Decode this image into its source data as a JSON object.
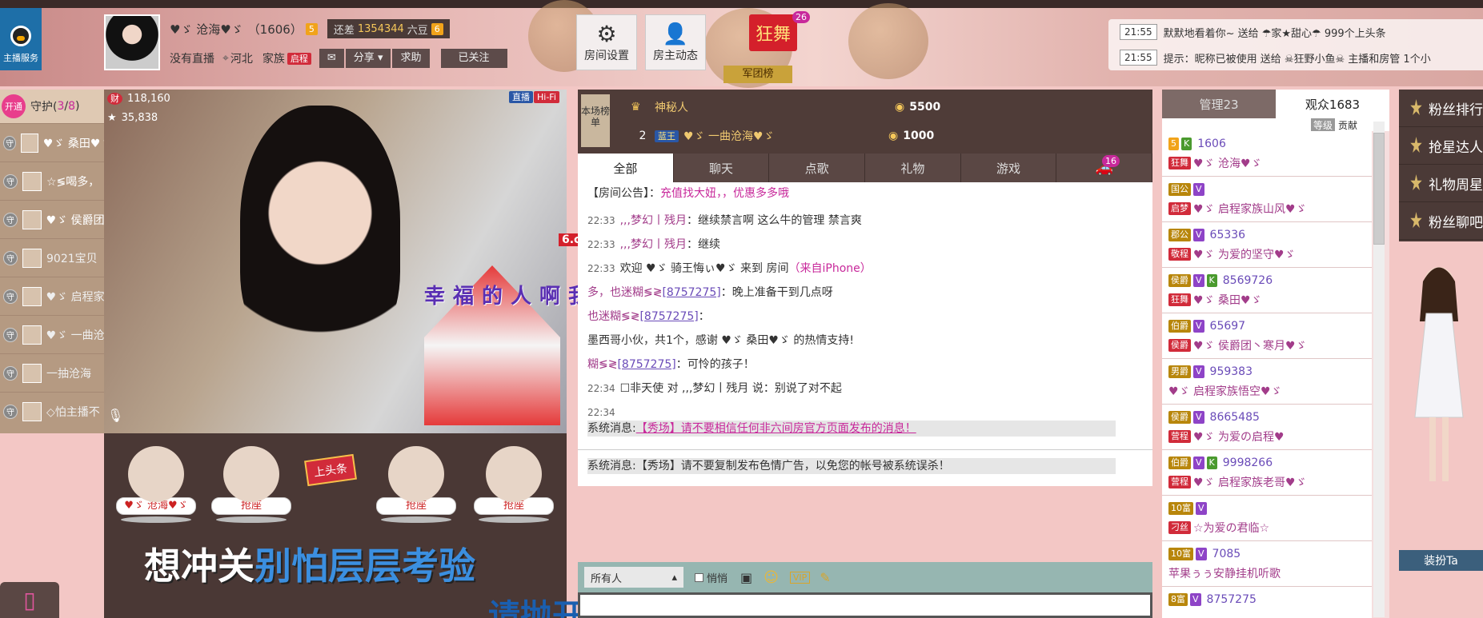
{
  "service": {
    "label": "主播服务"
  },
  "anchor": {
    "name": "♥ゞ 沧海♥ゞ",
    "id": "（1606）",
    "level": "5",
    "remaining_label": "还差",
    "remaining_value": "1354344",
    "remaining_unit": "六豆",
    "next_level": "6",
    "status": "没有直播",
    "location": "河北",
    "family_label": "家族",
    "family_badge": "启程",
    "share": "分享",
    "help": "求助",
    "followed": "已关注"
  },
  "header_tiles": [
    {
      "label": "房间设置",
      "icon": "gear-icon"
    },
    {
      "label": "房主动态",
      "icon": "user-icon"
    }
  ],
  "promo": {
    "label": "狂舞",
    "count": "26",
    "sub": "军团榜"
  },
  "news": [
    {
      "time": "21:55",
      "text": "默默地看着你~ 送给 ☂家★甜心☂ 999个上头条"
    },
    {
      "time": "21:55",
      "text": "提示：昵称已被使用 送给 ☠狂野小鱼☠ 主播和房管 1个小"
    }
  ],
  "guard": {
    "open": "开通",
    "title": "守护(",
    "count": "3",
    "sep": "/",
    "total": "8",
    "close": ")",
    "items": [
      {
        "badge": "守",
        "name": "♥ゞ 桑田♥ゞ",
        "active": true
      },
      {
        "badge": "守",
        "name": "☆≶喝多，",
        "active": true
      },
      {
        "badge": "守",
        "name": "♥ゞ 侯爵团",
        "active": true
      },
      {
        "badge": "守",
        "name": "9021宝贝",
        "active": false
      },
      {
        "badge": "守",
        "name": "♥ゞ 启程家",
        "active": false
      },
      {
        "badge": "守",
        "name": "♥ゞ 一曲沧",
        "active": false
      },
      {
        "badge": "守",
        "name": "一抽沧海",
        "active": false
      },
      {
        "badge": "守",
        "name": "◇怕主播不",
        "active": false
      }
    ]
  },
  "video": {
    "wealth_label": "财",
    "wealth": "118,160",
    "stars": "35,838",
    "live_tag": "直播",
    "hifi_tag": "Hi-Fi",
    "logo": "6.cn",
    "art_text": "幸福的人啊我"
  },
  "seats": [
    {
      "label": "♥ゞ 沧海♥ゞ"
    },
    {
      "label": "抢座"
    },
    {
      "label": "抢座"
    },
    {
      "label": "抢座"
    },
    {
      "label": "抢座"
    }
  ],
  "headline_sign": "上头条",
  "slogan_white": "想冲关",
  "slogan_blue": "别怕层层考验",
  "slogan_bottom": "请抛开怀疑背叛谎言",
  "ranking": {
    "label": "本场榜单",
    "rows": [
      {
        "rank": "",
        "name": "神秘人",
        "amount": "5500"
      },
      {
        "rank": "2",
        "badge": "蓝王",
        "name": "♥ゞ 一曲沧海♥ゞ",
        "amount": "1000"
      }
    ]
  },
  "tabs": [
    "全部",
    "聊天",
    "点歌",
    "礼物",
    "游戏"
  ],
  "car_count": "16",
  "chat": {
    "announcement_label": "【房间公告】：",
    "announcement_text": "充值找大妞，，优惠多多哦",
    "lines": [
      {
        "time": "22:33",
        "name": ",,,梦幻丨残月",
        "text": "：继续禁言啊 这么牛的管理 禁言爽"
      },
      {
        "time": "22:33",
        "name": ",,,梦幻丨残月",
        "text": "：继续"
      },
      {
        "time": "22:33",
        "text": "欢迎 ♥ゞ 骑王悔ぃ♥ゞ 来到 房间",
        "extra": "（来自iPhone）"
      },
      {
        "time": "",
        "name": "多，也迷糊≶≷",
        "id": "[8757275]",
        "text": "：晚上准备干到几点呀"
      },
      {
        "time": "",
        "name": "也迷糊≶≷",
        "id": "[8757275]",
        "text": "："
      },
      {
        "time": "",
        "text": "墨西哥小伙，共1个，感谢 ♥ゞ 桑田♥ゞ  的热情支持!"
      },
      {
        "time": "",
        "name": "糊≶≷",
        "id": "[8757275]",
        "text": "：可怜的孩子！"
      },
      {
        "time": "22:34",
        "text": "☐非天使 对 ,,,梦幻丨残月 说：别说了对不起"
      }
    ],
    "time_footer": "22:34",
    "sys_label": "系统消息:",
    "sys1": "【秀场】请不要相信任何非六间房官方页面发布的消息！",
    "sys2": "【秀场】请不要复制发布色情广告，以免您的帐号被系统误杀！"
  },
  "chatbar": {
    "target": "所有人",
    "whisper": "悄悄"
  },
  "right": {
    "tab_admin": "管理23",
    "tab_audience": "观众1683",
    "col_level": "等级",
    "col_contrib": "贡献",
    "users": [
      {
        "badges": [
          "5",
          "K"
        ],
        "id": "1606",
        "tag": "狂舞",
        "name": "♥ゞ 沧海♥ゞ"
      },
      {
        "badges": [
          "国公",
          "V"
        ],
        "id": "",
        "tag": "启梦",
        "name": "♥ゞ 启程家族山风♥ゞ"
      },
      {
        "badges": [
          "郡公",
          "V"
        ],
        "id": "65336",
        "tag": "敬程",
        "name": "♥ゞ 为爱的坚守♥ゞ"
      },
      {
        "badges": [
          "侯爵",
          "V",
          "K"
        ],
        "id": "8569726",
        "tag": "狂舞",
        "name": "♥ゞ 桑田♥ゞ"
      },
      {
        "badges": [
          "伯爵",
          "V"
        ],
        "id": "65697",
        "tag": "侯爵",
        "name": "♥ゞ 侯爵团丶寒月♥ゞ"
      },
      {
        "badges": [
          "男爵",
          "V"
        ],
        "id": "959383",
        "tag": "",
        "name": "♥ゞ 启程家族悟空♥ゞ"
      },
      {
        "badges": [
          "侯爵",
          "V"
        ],
        "id": "8665485",
        "tag": "营程",
        "name": "♥ゞ 为爱の启程♥"
      },
      {
        "badges": [
          "伯爵",
          "V",
          "K"
        ],
        "id": "9998266",
        "tag": "营程",
        "name": "♥ゞ 启程家族老哥♥ゞ"
      },
      {
        "badges": [
          "10富",
          "V"
        ],
        "id": "",
        "tag": "刁丝",
        "name": "☆为爱の君临☆"
      },
      {
        "badges": [
          "10富",
          "V"
        ],
        "id": "7085",
        "tag": "",
        "name": "苹果ぅぅ安静挂机听歌"
      },
      {
        "badges": [
          "8富",
          "V"
        ],
        "id": "8757275",
        "tag": "",
        "name": ""
      }
    ]
  },
  "sidemenu": [
    "粉丝排行",
    "抢星达人",
    "礼物周星",
    "粉丝聊吧"
  ],
  "dress": "装扮Ta",
  "colors": {
    "accent": "#c8299b",
    "brown": "#4b3a37",
    "pink_bg": "#f3c7c5",
    "purple_name": "#a23c8a"
  }
}
